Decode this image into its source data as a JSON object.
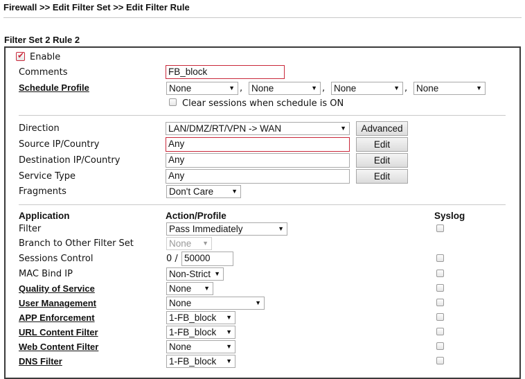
{
  "breadcrumb": "Firewall >> Edit Filter Set >> Edit Filter Rule",
  "set_title": "Filter Set 2 Rule 2",
  "enable": {
    "label": "Enable",
    "checked": true
  },
  "comments": {
    "label": "Comments",
    "value": "FB_block"
  },
  "schedule": {
    "label": "Schedule Profile",
    "profiles": [
      "None",
      "None",
      "None",
      "None"
    ],
    "clear_label": "Clear sessions when schedule is ON"
  },
  "direction": {
    "label": "Direction",
    "value": "LAN/DMZ/RT/VPN -> WAN",
    "button": "Advanced"
  },
  "source": {
    "label": "Source IP/Country",
    "value": "Any",
    "button": "Edit"
  },
  "destination": {
    "label": "Destination IP/Country",
    "value": "Any",
    "button": "Edit"
  },
  "service": {
    "label": "Service Type",
    "value": "Any",
    "button": "Edit"
  },
  "fragments": {
    "label": "Fragments",
    "value": "Don't Care"
  },
  "headers": {
    "application": "Application",
    "action": "Action/Profile",
    "syslog": "Syslog"
  },
  "filter": {
    "label": "Filter",
    "value": "Pass Immediately"
  },
  "branch": {
    "label": "Branch to Other Filter Set",
    "value": "None"
  },
  "sessions": {
    "label": "Sessions Control",
    "current": "0 /",
    "max": "50000"
  },
  "mac": {
    "label": "MAC Bind IP",
    "value": "Non-Strict"
  },
  "qos": {
    "label": "Quality of Service",
    "value": "None"
  },
  "user": {
    "label": "User Management",
    "value": "None"
  },
  "app": {
    "label": "APP Enforcement",
    "value": "1-FB_block"
  },
  "url": {
    "label": "URL Content Filter",
    "value": "1-FB_block"
  },
  "web": {
    "label": "Web Content Filter",
    "value": "None"
  },
  "dns": {
    "label": "DNS Filter",
    "value": "1-FB_block"
  },
  "colors": {
    "accent_red": "#c9283a",
    "border": "#3a3a3a"
  }
}
